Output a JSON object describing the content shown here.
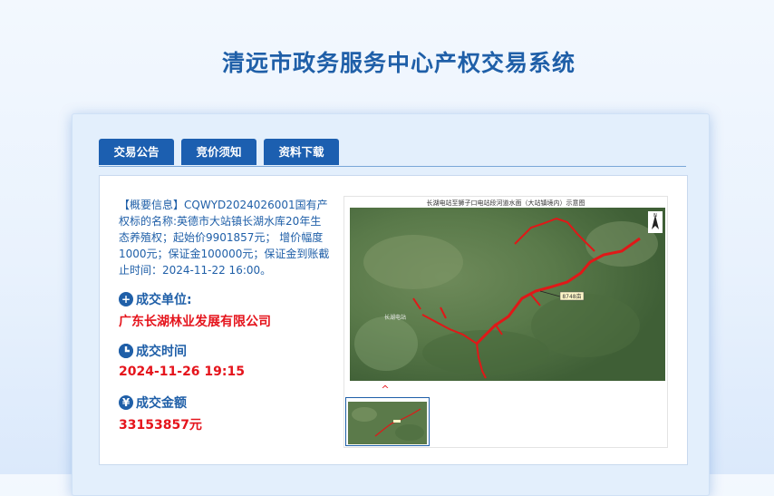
{
  "page": {
    "title": "清远市政务服务中心产权交易系统"
  },
  "tabs": [
    {
      "label": "交易公告"
    },
    {
      "label": "竞价须知"
    },
    {
      "label": "资料下载"
    }
  ],
  "overview": {
    "text": "【概要信息】CQWYD2024026001国有产权标的名称:英德市大站镇长湖水库20年生态养殖权；起始价9901857元； 增价幅度1000元；保证金100000元；保证金到账截止时间：2024-11-22 16:00。"
  },
  "deal": {
    "unit_label": "成交单位:",
    "unit_value": "广东长湖林业发展有限公司",
    "time_label": "成交时间",
    "time_value": "2024-11-26 19:15",
    "amount_label": "成交金额",
    "amount_value": "33153857元"
  },
  "icons": {
    "unit": "plus-circle-icon",
    "time": "clock-icon",
    "amount": "yen-circle-icon"
  },
  "map": {
    "caption": "长湖电站至狮子口电站段河道水面（大站镇境内）示意图",
    "area_label": "8748亩",
    "place_label": "长湖电站",
    "north": "N"
  },
  "colors": {
    "brand": "#1c5fb0",
    "accent_red": "#e5141c"
  }
}
